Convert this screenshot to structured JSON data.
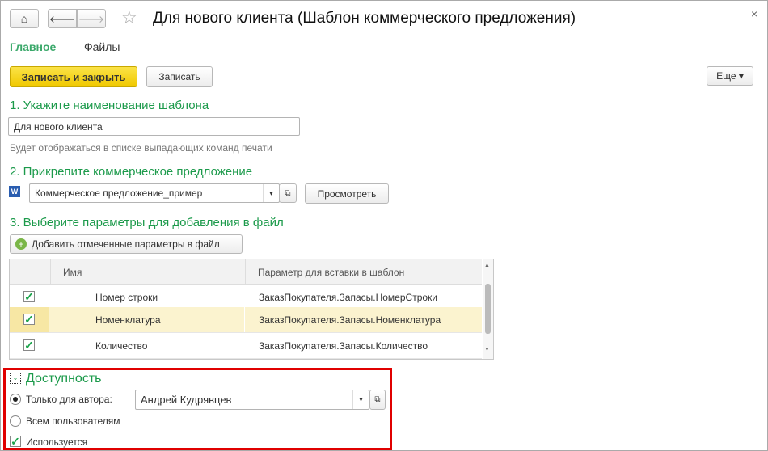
{
  "window": {
    "title": "Для нового клиента (Шаблон коммерческого предложения)"
  },
  "tabs": [
    {
      "label": "Главное",
      "active": true
    },
    {
      "label": "Файлы",
      "active": false
    }
  ],
  "toolbar": {
    "save_close": "Записать и закрыть",
    "save": "Записать",
    "more": "Еще"
  },
  "section1": {
    "heading": "1. Укажите наименование шаблона",
    "value": "Для нового клиента",
    "hint": "Будет отображаться в списке выпадающих команд печати"
  },
  "section2": {
    "heading": "2. Прикрепите коммерческое предложение",
    "file": "Коммерческое предложение_пример",
    "view": "Просмотреть"
  },
  "section3": {
    "heading": "3. Выберите параметры для добавления в файл",
    "add_button": "Добавить отмеченные параметры в файл",
    "columns": [
      "Имя",
      "Параметр для вставки в шаблон"
    ],
    "rows": [
      {
        "checked": true,
        "name": "Номер строки",
        "param": "ЗаказПокупателя.Запасы.НомерСтроки"
      },
      {
        "checked": true,
        "name": "Номенклатура",
        "param": "ЗаказПокупателя.Запасы.Номенклатура",
        "selected": true
      },
      {
        "checked": true,
        "name": "Количество",
        "param": "ЗаказПокупателя.Запасы.Количество"
      }
    ]
  },
  "availability": {
    "heading": "Доступность",
    "author_only": "Только для автора:",
    "author": "Андрей Кудрявцев",
    "all_users": "Всем пользователям",
    "used": "Используется",
    "selected": "author_only",
    "used_checked": true
  },
  "colors": {
    "accent": "#1c9a4b",
    "primary_button": "#f5d30a",
    "highlight": "#fbf3cf",
    "frame": "#e00000"
  }
}
